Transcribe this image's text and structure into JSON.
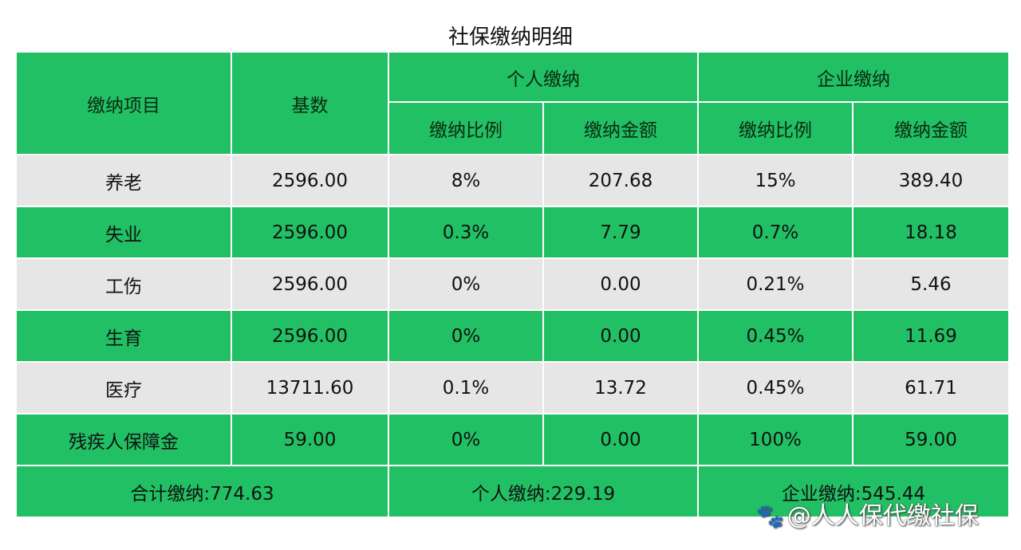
{
  "title": "社保缴纳明细",
  "colors": {
    "green": "#22c065",
    "gray": "#e6e6e6"
  },
  "header": {
    "item": "缴纳项目",
    "base": "基数",
    "personal": "个人缴纳",
    "company": "企业缴纳",
    "rate": "缴纳比例",
    "amount": "缴纳金额"
  },
  "rows": [
    {
      "item": "养老",
      "base": "2596.00",
      "p_rate": "8%",
      "p_amount": "207.68",
      "c_rate": "15%",
      "c_amount": "389.40"
    },
    {
      "item": "失业",
      "base": "2596.00",
      "p_rate": "0.3%",
      "p_amount": "7.79",
      "c_rate": "0.7%",
      "c_amount": "18.18"
    },
    {
      "item": "工伤",
      "base": "2596.00",
      "p_rate": "0%",
      "p_amount": "0.00",
      "c_rate": "0.21%",
      "c_amount": "5.46"
    },
    {
      "item": "生育",
      "base": "2596.00",
      "p_rate": "0%",
      "p_amount": "0.00",
      "c_rate": "0.45%",
      "c_amount": "11.69"
    },
    {
      "item": "医疗",
      "base": "13711.60",
      "p_rate": "0.1%",
      "p_amount": "13.72",
      "c_rate": "0.45%",
      "c_amount": "61.71"
    },
    {
      "item": "残疾人保障金",
      "base": "59.00",
      "p_rate": "0%",
      "p_amount": "0.00",
      "c_rate": "100%",
      "c_amount": "59.00"
    }
  ],
  "totals": {
    "total": "合计缴纳:774.63",
    "personal": "个人缴纳:229.19",
    "company": "企业缴纳:545.44"
  },
  "watermark": "@人人保代缴社保",
  "watermark_icon": "paw-icon"
}
